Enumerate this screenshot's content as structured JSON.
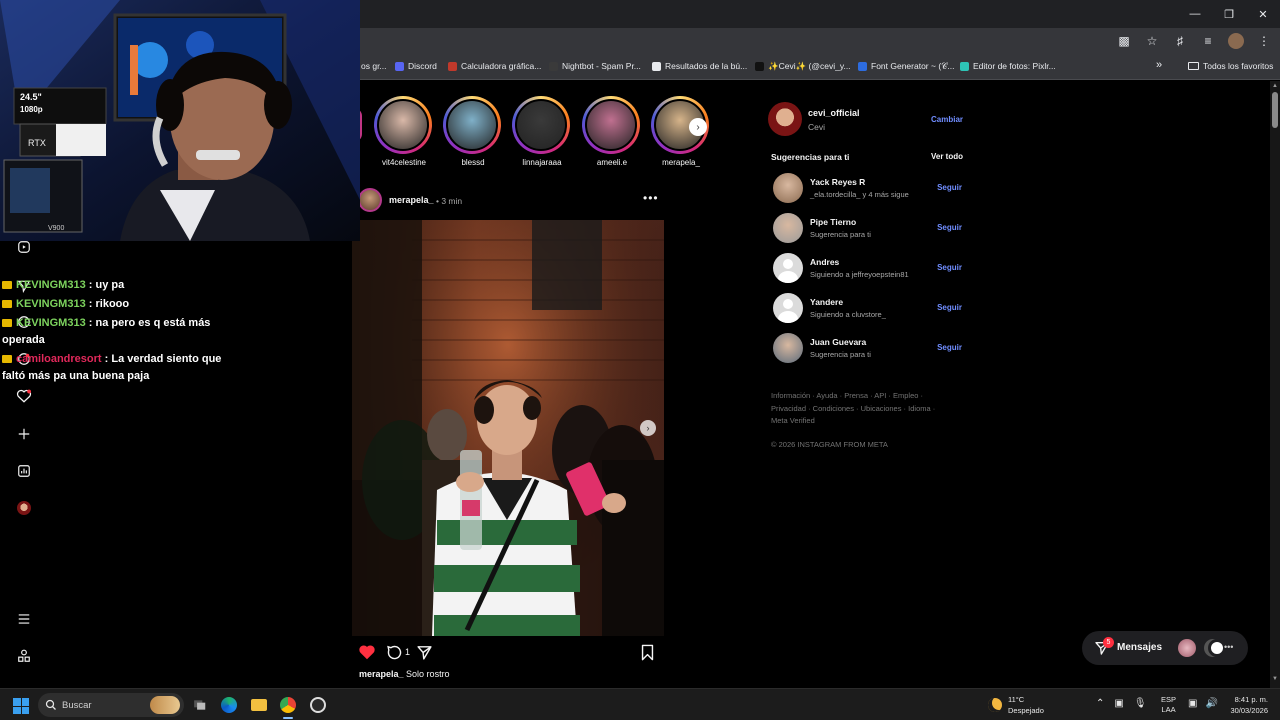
{
  "browser": {
    "window_controls": [
      "minimize",
      "maximize",
      "close"
    ],
    "bookmarks": [
      {
        "label": "os gr...",
        "icon": "bookmark-icon",
        "color": "#9aa0a6"
      },
      {
        "label": "Discord",
        "icon": "discord-icon",
        "color": "#5865f2"
      },
      {
        "label": "Calculadora gráfica...",
        "icon": "calculator-icon",
        "color": "#c0392b"
      },
      {
        "label": "Nightbot - Spam Pr...",
        "icon": "nightbot-icon",
        "color": "#3a3a3a"
      },
      {
        "label": "Resultados de la bú...",
        "icon": "document-icon",
        "color": "#e8eaed"
      },
      {
        "label": "✨Cevi✨ (@cevi_y...",
        "icon": "tiktok-icon",
        "color": "#111111"
      },
      {
        "label": "Font Generator ~ (𝒞...",
        "icon": "font-icon",
        "color": "#2d6cdf"
      },
      {
        "label": "Editor de fotos: Pixlr...",
        "icon": "pixlr-icon",
        "color": "#2ec4b6"
      }
    ],
    "all_favorites": "Todos los favoritos"
  },
  "stories": [
    {
      "name": "vit4celestine",
      "color": "#d9b8a8"
    },
    {
      "name": "blessd",
      "color": "#7fb0c8"
    },
    {
      "name": "linnajaraaa",
      "color": "#3a3a3a"
    },
    {
      "name": "ameeli.e",
      "color": "#c07090"
    },
    {
      "name": "merapela_",
      "color": "#d6b48a"
    }
  ],
  "post": {
    "username": "merapela_",
    "time": "• 3 min",
    "comment_count": "1",
    "caption_user": "merapela_",
    "caption_text": "Solo rostro"
  },
  "sidebar": {
    "me_username": "cevi_official",
    "me_name": "Cevi",
    "switch_label": "Cambiar",
    "suggestions_title": "Sugerencias para ti",
    "see_all": "Ver todo",
    "follow_label": "Seguir",
    "suggestions": [
      {
        "name": "Yack Reyes R",
        "sub": "_ela.tordecilla_ y 4 más sigue",
        "avatar": "#8a6a50",
        "default": false
      },
      {
        "name": "Pipe Tierno",
        "sub": "Sugerencia para ti",
        "avatar": "#9a9a9a",
        "default": false
      },
      {
        "name": "Andres",
        "sub": "Siguiendo a jeffreyoepstein81",
        "avatar": "",
        "default": true
      },
      {
        "name": "Yandere",
        "sub": "Siguiendo a cluvstore_",
        "avatar": "",
        "default": true
      },
      {
        "name": "Juan Guevara",
        "sub": "Sugerencia para ti",
        "avatar": "#5a6a7a",
        "default": false
      }
    ],
    "footer_links": "Información · Ayuda · Prensa · API · Empleo · Privacidad · Condiciones · Ubicaciones · Idioma · Meta Verified",
    "copyright": "© 2026 INSTAGRAM FROM META"
  },
  "messages": {
    "label": "Mensajes",
    "badge": "5"
  },
  "chat": [
    {
      "user": "KEVINGM313",
      "text": ": uy pa",
      "style": "green"
    },
    {
      "user": "KEVINGM313",
      "text": ": rikooo",
      "style": "green"
    },
    {
      "user": "KEVINGM313",
      "text": ": na pero es q está más operada",
      "style": "green"
    },
    {
      "user": "camiloandresort",
      "text": ": La verdad siento que faltó más pa una buena paja",
      "style": "red"
    }
  ],
  "webcam": {
    "monitor_label_1": "24.5\"",
    "monitor_label_2": "1080p",
    "gpu_label": "RTX",
    "case_label": "V900"
  },
  "taskbar": {
    "search_label": "Buscar",
    "weather_temp": "11°C",
    "weather_desc": "Despejado",
    "lang_1": "ESP",
    "lang_2": "LAA",
    "time": "8:41 p. m.",
    "date": "30/03/2026"
  }
}
